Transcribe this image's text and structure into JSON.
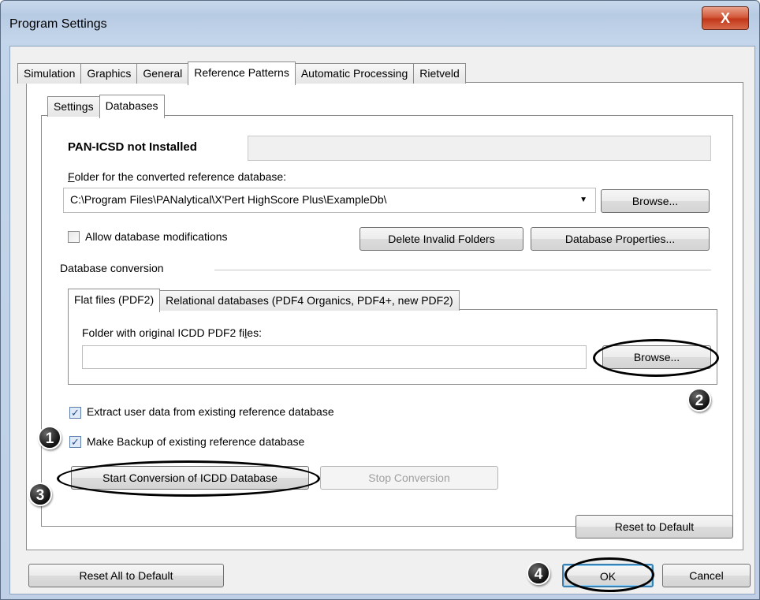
{
  "window": {
    "title": "Program Settings",
    "close_glyph": "X"
  },
  "main_tabs": [
    {
      "label": "Simulation"
    },
    {
      "label": "Graphics"
    },
    {
      "label": "General"
    },
    {
      "label": "Reference Patterns",
      "active": true
    },
    {
      "label": "Automatic Processing"
    },
    {
      "label": "Rietveld"
    }
  ],
  "sub_tabs": [
    {
      "label": "Settings"
    },
    {
      "label": "Databases",
      "active": true
    }
  ],
  "databases": {
    "status_label": "PAN-ICSD not Installed",
    "folder_label_first": "F",
    "folder_label_rest": "older for the converted reference database:",
    "folder_path": "C:\\Program Files\\PANalytical\\X'Pert HighScore Plus\\ExampleDb\\",
    "browse_label": "Browse...",
    "allow_mod_label": "Allow database modifications",
    "allow_mod_checked": false,
    "delete_invalid_label": "Delete Invalid Folders",
    "db_properties_label": "Database Properties..."
  },
  "conversion": {
    "section_label": "Database conversion",
    "tabs": [
      {
        "label": "Flat files (PDF2)",
        "active": true
      },
      {
        "label": "Relational databases (PDF4 Organics, PDF4+, new PDF2)"
      }
    ],
    "folder_label_pre": "Folder with original ICDD PDF2 fi",
    "folder_label_underlined": "l",
    "folder_label_post": "es:",
    "folder_value": "",
    "browse_label": "Browse...",
    "extract_label": "Extract user data from existing reference database",
    "extract_checked": true,
    "backup_label": "Make Backup of existing reference database",
    "backup_checked": true,
    "start_label": "Start Conversion of ICDD Database",
    "stop_label": "Stop Conversion",
    "reset_label": "Reset to Default"
  },
  "footer": {
    "reset_all_label": "Reset All to Default",
    "ok_label": "OK",
    "cancel_label": "Cancel"
  },
  "callouts": [
    "1",
    "2",
    "3",
    "4"
  ],
  "check_glyph": "✓"
}
